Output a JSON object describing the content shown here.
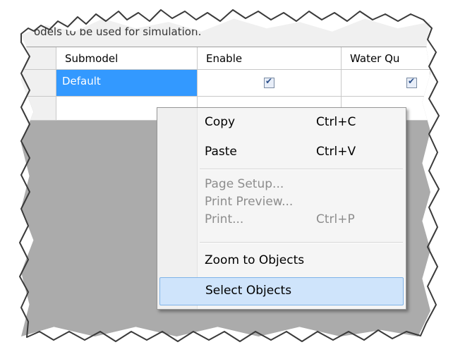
{
  "caption": "odels to be used for simulation:",
  "grid": {
    "columns": [
      "Submodel",
      "Enable",
      "Water Qu"
    ],
    "rows": [
      {
        "submodel": "Default",
        "enable": true,
        "water_quality": true
      }
    ]
  },
  "context_menu": {
    "items": [
      {
        "label": "Copy",
        "shortcut": "Ctrl+C",
        "enabled": true
      },
      {
        "label": "Paste",
        "shortcut": "Ctrl+V",
        "enabled": true
      },
      {
        "label": "Page Setup...",
        "shortcut": "",
        "enabled": false
      },
      {
        "label": "Print Preview...",
        "shortcut": "",
        "enabled": false
      },
      {
        "label": "Print...",
        "shortcut": "Ctrl+P",
        "enabled": false
      },
      {
        "label": "Zoom to Objects",
        "shortcut": "",
        "enabled": true
      },
      {
        "label": "Select Objects",
        "shortcut": "",
        "enabled": true,
        "highlighted": true
      }
    ]
  },
  "colors": {
    "selection": "#3399ff",
    "menu_highlight": "#cfe4fb",
    "grid_background": "#ababab"
  }
}
